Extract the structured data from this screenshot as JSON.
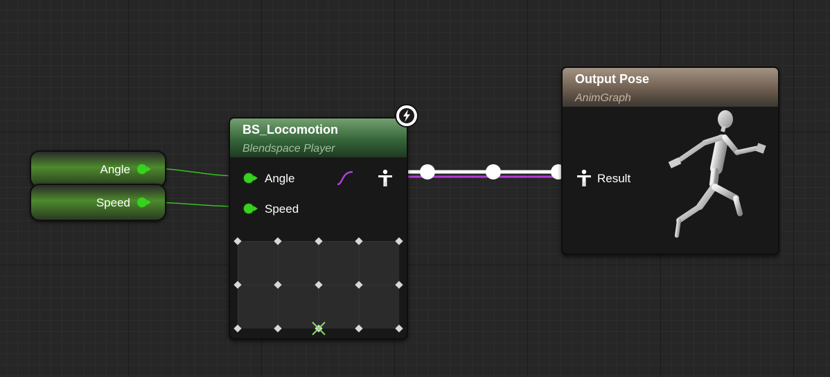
{
  "variables": [
    {
      "label": "Angle"
    },
    {
      "label": "Speed"
    }
  ],
  "blendspace_node": {
    "title": "BS_Locomotion",
    "subtitle": "Blendspace Player",
    "inputs": [
      "Angle",
      "Speed"
    ],
    "icon": "lightning-bolt-icon"
  },
  "output_node": {
    "title": "Output Pose",
    "subtitle": "AnimGraph",
    "input_label": "Result",
    "preview": "running-mannequin"
  },
  "colors": {
    "float_pin": "#38d11f",
    "pose_wire": "#ffffff",
    "exec_wire": "#b43dd6",
    "blendspace_header": "#4d7d4f",
    "output_header": "#8c7b6a"
  }
}
